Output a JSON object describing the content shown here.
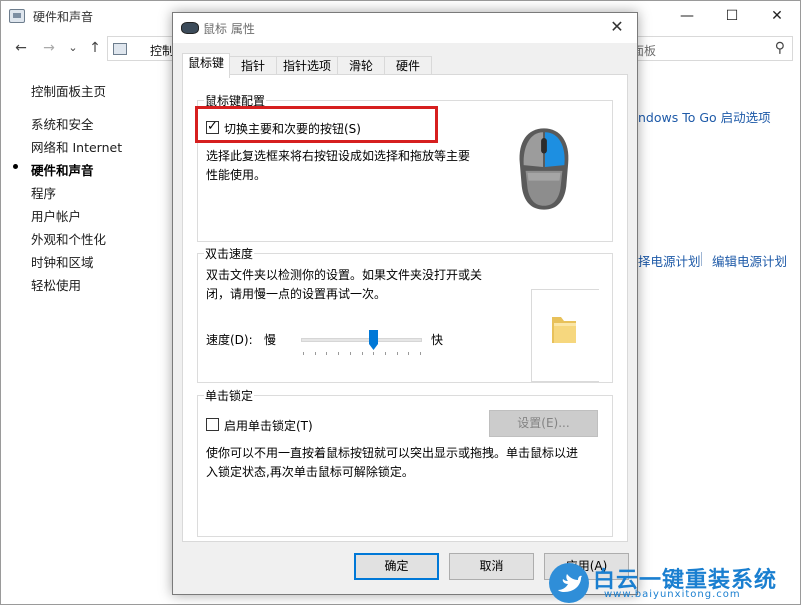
{
  "background_window": {
    "title": "硬件和声音",
    "controls": {
      "minimize": "—",
      "maximize": "☐",
      "close": "✕"
    },
    "nav": {
      "back": "←",
      "forward": "→",
      "dropdown": "⌄",
      "up": "↑"
    },
    "breadcrumb": "控制",
    "search_placeholder": "面板",
    "search_icon": "⚲",
    "left_nav": {
      "home": "控制面板主页",
      "items": [
        "系统和安全",
        "网络和 Internet",
        "硬件和声音",
        "程序",
        "用户帐户",
        "外观和个性化",
        "时钟和区域",
        "轻松使用"
      ],
      "active_index": 2
    },
    "links": {
      "windows_to_go": "ndows To Go 启动选项",
      "power_plan": "择电源计划",
      "edit_power_plan": "编辑电源计划"
    }
  },
  "dialog": {
    "title": "鼠标 属性",
    "close": "✕",
    "tabs": [
      "鼠标键",
      "指针",
      "指针选项",
      "滑轮",
      "硬件"
    ],
    "selected_tab": 0,
    "button_config": {
      "group_label": "鼠标键配置",
      "checkbox_label": "切换主要和次要的按钮(S)",
      "checked": true,
      "description_1": "选择此复选框来将右按钮设成如选择和拖放等主要",
      "description_2": "性能使用。"
    },
    "double_click": {
      "group_label": "双击速度",
      "description_1": "双击文件夹以检测你的设置。如果文件夹没打开或关",
      "description_2": "闭，请用慢一点的设置再试一次。",
      "speed_label": "速度(D):",
      "slow": "慢",
      "fast": "快",
      "speed_fraction": 0.6
    },
    "click_lock": {
      "group_label": "单击锁定",
      "checkbox_label": "启用单击锁定(T)",
      "checked": false,
      "settings_button": "设置(E)...",
      "description_1": "使你可以不用一直按着鼠标按钮就可以突出显示或拖拽。单击鼠标以进",
      "description_2": "入锁定状态,再次单击鼠标可解除锁定。"
    },
    "buttons": {
      "ok": "确定",
      "cancel": "取消",
      "apply": "应用(A)"
    }
  },
  "watermark": {
    "text": "白云一键重装系统",
    "url": "www.baiyunxitong.com"
  },
  "colors": {
    "highlight_box": "#d61f1f",
    "link": "#1e5aa8",
    "mouse_accent": "#1d8fe1",
    "watermark": "#1a7fd0"
  }
}
